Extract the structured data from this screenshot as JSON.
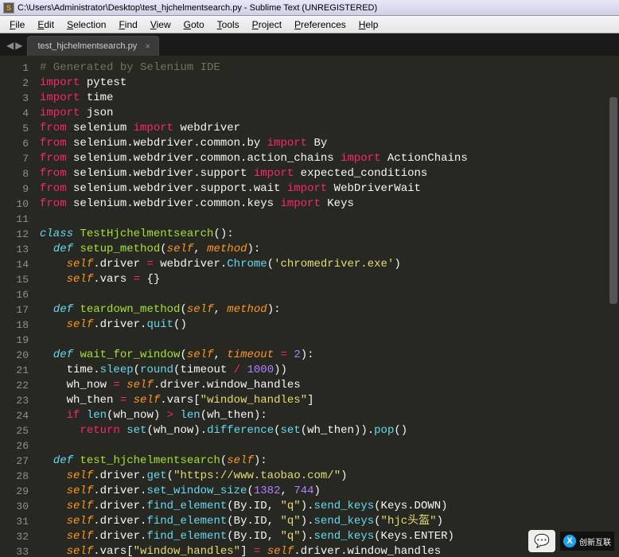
{
  "window": {
    "title": "C:\\Users\\Administrator\\Desktop\\test_hjchelmentsearch.py - Sublime Text (UNREGISTERED)"
  },
  "menu": {
    "items": [
      "File",
      "Edit",
      "Selection",
      "Find",
      "View",
      "Goto",
      "Tools",
      "Project",
      "Preferences",
      "Help"
    ]
  },
  "tab": {
    "name": "test_hjchelmentsearch.py",
    "close": "×"
  },
  "code": {
    "lines": [
      [
        {
          "t": "# Generated by Selenium IDE",
          "c": "c-comment"
        }
      ],
      [
        {
          "t": "import",
          "c": "c-keyword"
        },
        {
          "t": " pytest",
          "c": "c-plain"
        }
      ],
      [
        {
          "t": "import",
          "c": "c-keyword"
        },
        {
          "t": " time",
          "c": "c-plain"
        }
      ],
      [
        {
          "t": "import",
          "c": "c-keyword"
        },
        {
          "t": " json",
          "c": "c-plain"
        }
      ],
      [
        {
          "t": "from",
          "c": "c-keyword"
        },
        {
          "t": " selenium ",
          "c": "c-plain"
        },
        {
          "t": "import",
          "c": "c-keyword"
        },
        {
          "t": " webdriver",
          "c": "c-plain"
        }
      ],
      [
        {
          "t": "from",
          "c": "c-keyword"
        },
        {
          "t": " selenium.webdriver.common.by ",
          "c": "c-plain"
        },
        {
          "t": "import",
          "c": "c-keyword"
        },
        {
          "t": " By",
          "c": "c-plain"
        }
      ],
      [
        {
          "t": "from",
          "c": "c-keyword"
        },
        {
          "t": " selenium.webdriver.common.action_chains ",
          "c": "c-plain"
        },
        {
          "t": "import",
          "c": "c-keyword"
        },
        {
          "t": " ActionChains",
          "c": "c-plain"
        }
      ],
      [
        {
          "t": "from",
          "c": "c-keyword"
        },
        {
          "t": " selenium.webdriver.support ",
          "c": "c-plain"
        },
        {
          "t": "import",
          "c": "c-keyword"
        },
        {
          "t": " expected_conditions",
          "c": "c-plain"
        }
      ],
      [
        {
          "t": "from",
          "c": "c-keyword"
        },
        {
          "t": " selenium.webdriver.support.wait ",
          "c": "c-plain"
        },
        {
          "t": "import",
          "c": "c-keyword"
        },
        {
          "t": " WebDriverWait",
          "c": "c-plain"
        }
      ],
      [
        {
          "t": "from",
          "c": "c-keyword"
        },
        {
          "t": " selenium.webdriver.common.keys ",
          "c": "c-plain"
        },
        {
          "t": "import",
          "c": "c-keyword"
        },
        {
          "t": " Keys",
          "c": "c-plain"
        }
      ],
      [
        {
          "t": "",
          "c": "c-plain"
        }
      ],
      [
        {
          "t": "class",
          "c": "c-storage"
        },
        {
          "t": " ",
          "c": "c-plain"
        },
        {
          "t": "TestHjchelmentsearch",
          "c": "c-funcname"
        },
        {
          "t": "():",
          "c": "c-plain"
        }
      ],
      [
        {
          "t": "  ",
          "c": "c-plain"
        },
        {
          "t": "def",
          "c": "c-storage"
        },
        {
          "t": " ",
          "c": "c-plain"
        },
        {
          "t": "setup_method",
          "c": "c-funcname"
        },
        {
          "t": "(",
          "c": "c-plain"
        },
        {
          "t": "self",
          "c": "c-param"
        },
        {
          "t": ", ",
          "c": "c-plain"
        },
        {
          "t": "method",
          "c": "c-param"
        },
        {
          "t": "):",
          "c": "c-plain"
        }
      ],
      [
        {
          "t": "    ",
          "c": "c-plain"
        },
        {
          "t": "self",
          "c": "c-param"
        },
        {
          "t": ".driver ",
          "c": "c-plain"
        },
        {
          "t": "=",
          "c": "c-keyword"
        },
        {
          "t": " webdriver.",
          "c": "c-plain"
        },
        {
          "t": "Chrome",
          "c": "c-call"
        },
        {
          "t": "(",
          "c": "c-plain"
        },
        {
          "t": "'chromedriver.exe'",
          "c": "c-string"
        },
        {
          "t": ")",
          "c": "c-plain"
        }
      ],
      [
        {
          "t": "    ",
          "c": "c-plain"
        },
        {
          "t": "self",
          "c": "c-param"
        },
        {
          "t": ".vars ",
          "c": "c-plain"
        },
        {
          "t": "=",
          "c": "c-keyword"
        },
        {
          "t": " {}",
          "c": "c-plain"
        }
      ],
      [
        {
          "t": "",
          "c": "c-plain"
        }
      ],
      [
        {
          "t": "  ",
          "c": "c-plain"
        },
        {
          "t": "def",
          "c": "c-storage"
        },
        {
          "t": " ",
          "c": "c-plain"
        },
        {
          "t": "teardown_method",
          "c": "c-funcname"
        },
        {
          "t": "(",
          "c": "c-plain"
        },
        {
          "t": "self",
          "c": "c-param"
        },
        {
          "t": ", ",
          "c": "c-plain"
        },
        {
          "t": "method",
          "c": "c-param"
        },
        {
          "t": "):",
          "c": "c-plain"
        }
      ],
      [
        {
          "t": "    ",
          "c": "c-plain"
        },
        {
          "t": "self",
          "c": "c-param"
        },
        {
          "t": ".driver.",
          "c": "c-plain"
        },
        {
          "t": "quit",
          "c": "c-call"
        },
        {
          "t": "()",
          "c": "c-plain"
        }
      ],
      [
        {
          "t": "",
          "c": "c-plain"
        }
      ],
      [
        {
          "t": "  ",
          "c": "c-plain"
        },
        {
          "t": "def",
          "c": "c-storage"
        },
        {
          "t": " ",
          "c": "c-plain"
        },
        {
          "t": "wait_for_window",
          "c": "c-funcname"
        },
        {
          "t": "(",
          "c": "c-plain"
        },
        {
          "t": "self",
          "c": "c-param"
        },
        {
          "t": ", ",
          "c": "c-plain"
        },
        {
          "t": "timeout",
          "c": "c-param"
        },
        {
          "t": " ",
          "c": "c-plain"
        },
        {
          "t": "=",
          "c": "c-keyword"
        },
        {
          "t": " ",
          "c": "c-plain"
        },
        {
          "t": "2",
          "c": "c-number"
        },
        {
          "t": "):",
          "c": "c-plain"
        }
      ],
      [
        {
          "t": "    time.",
          "c": "c-plain"
        },
        {
          "t": "sleep",
          "c": "c-call"
        },
        {
          "t": "(",
          "c": "c-plain"
        },
        {
          "t": "round",
          "c": "c-call"
        },
        {
          "t": "(timeout ",
          "c": "c-plain"
        },
        {
          "t": "/",
          "c": "c-keyword"
        },
        {
          "t": " ",
          "c": "c-plain"
        },
        {
          "t": "1000",
          "c": "c-number"
        },
        {
          "t": "))",
          "c": "c-plain"
        }
      ],
      [
        {
          "t": "    wh_now ",
          "c": "c-plain"
        },
        {
          "t": "=",
          "c": "c-keyword"
        },
        {
          "t": " ",
          "c": "c-plain"
        },
        {
          "t": "self",
          "c": "c-param"
        },
        {
          "t": ".driver.window_handles",
          "c": "c-plain"
        }
      ],
      [
        {
          "t": "    wh_then ",
          "c": "c-plain"
        },
        {
          "t": "=",
          "c": "c-keyword"
        },
        {
          "t": " ",
          "c": "c-plain"
        },
        {
          "t": "self",
          "c": "c-param"
        },
        {
          "t": ".vars[",
          "c": "c-plain"
        },
        {
          "t": "\"window_handles\"",
          "c": "c-string"
        },
        {
          "t": "]",
          "c": "c-plain"
        }
      ],
      [
        {
          "t": "    ",
          "c": "c-plain"
        },
        {
          "t": "if",
          "c": "c-keyword"
        },
        {
          "t": " ",
          "c": "c-plain"
        },
        {
          "t": "len",
          "c": "c-call"
        },
        {
          "t": "(wh_now) ",
          "c": "c-plain"
        },
        {
          "t": ">",
          "c": "c-keyword"
        },
        {
          "t": " ",
          "c": "c-plain"
        },
        {
          "t": "len",
          "c": "c-call"
        },
        {
          "t": "(wh_then):",
          "c": "c-plain"
        }
      ],
      [
        {
          "t": "      ",
          "c": "c-plain"
        },
        {
          "t": "return",
          "c": "c-keyword"
        },
        {
          "t": " ",
          "c": "c-plain"
        },
        {
          "t": "set",
          "c": "c-call"
        },
        {
          "t": "(wh_now).",
          "c": "c-plain"
        },
        {
          "t": "difference",
          "c": "c-call"
        },
        {
          "t": "(",
          "c": "c-plain"
        },
        {
          "t": "set",
          "c": "c-call"
        },
        {
          "t": "(wh_then)).",
          "c": "c-plain"
        },
        {
          "t": "pop",
          "c": "c-call"
        },
        {
          "t": "()",
          "c": "c-plain"
        }
      ],
      [
        {
          "t": "",
          "c": "c-plain"
        }
      ],
      [
        {
          "t": "  ",
          "c": "c-plain"
        },
        {
          "t": "def",
          "c": "c-storage"
        },
        {
          "t": " ",
          "c": "c-plain"
        },
        {
          "t": "test_hjchelmentsearch",
          "c": "c-funcname"
        },
        {
          "t": "(",
          "c": "c-plain"
        },
        {
          "t": "self",
          "c": "c-param"
        },
        {
          "t": "):",
          "c": "c-plain"
        }
      ],
      [
        {
          "t": "    ",
          "c": "c-plain"
        },
        {
          "t": "self",
          "c": "c-param"
        },
        {
          "t": ".driver.",
          "c": "c-plain"
        },
        {
          "t": "get",
          "c": "c-call"
        },
        {
          "t": "(",
          "c": "c-plain"
        },
        {
          "t": "\"https://www.taobao.com/\"",
          "c": "c-string"
        },
        {
          "t": ")",
          "c": "c-plain"
        }
      ],
      [
        {
          "t": "    ",
          "c": "c-plain"
        },
        {
          "t": "self",
          "c": "c-param"
        },
        {
          "t": ".driver.",
          "c": "c-plain"
        },
        {
          "t": "set_window_size",
          "c": "c-call"
        },
        {
          "t": "(",
          "c": "c-plain"
        },
        {
          "t": "1382",
          "c": "c-number"
        },
        {
          "t": ", ",
          "c": "c-plain"
        },
        {
          "t": "744",
          "c": "c-number"
        },
        {
          "t": ")",
          "c": "c-plain"
        }
      ],
      [
        {
          "t": "    ",
          "c": "c-plain"
        },
        {
          "t": "self",
          "c": "c-param"
        },
        {
          "t": ".driver.",
          "c": "c-plain"
        },
        {
          "t": "find_element",
          "c": "c-call"
        },
        {
          "t": "(By.ID, ",
          "c": "c-plain"
        },
        {
          "t": "\"q\"",
          "c": "c-string"
        },
        {
          "t": ").",
          "c": "c-plain"
        },
        {
          "t": "send_keys",
          "c": "c-call"
        },
        {
          "t": "(Keys.DOWN)",
          "c": "c-plain"
        }
      ],
      [
        {
          "t": "    ",
          "c": "c-plain"
        },
        {
          "t": "self",
          "c": "c-param"
        },
        {
          "t": ".driver.",
          "c": "c-plain"
        },
        {
          "t": "find_element",
          "c": "c-call"
        },
        {
          "t": "(By.ID, ",
          "c": "c-plain"
        },
        {
          "t": "\"q\"",
          "c": "c-string"
        },
        {
          "t": ").",
          "c": "c-plain"
        },
        {
          "t": "send_keys",
          "c": "c-call"
        },
        {
          "t": "(",
          "c": "c-plain"
        },
        {
          "t": "\"hjc头盔\"",
          "c": "c-string"
        },
        {
          "t": ")",
          "c": "c-plain"
        }
      ],
      [
        {
          "t": "    ",
          "c": "c-plain"
        },
        {
          "t": "self",
          "c": "c-param"
        },
        {
          "t": ".driver.",
          "c": "c-plain"
        },
        {
          "t": "find_element",
          "c": "c-call"
        },
        {
          "t": "(By.ID, ",
          "c": "c-plain"
        },
        {
          "t": "\"q\"",
          "c": "c-string"
        },
        {
          "t": ").",
          "c": "c-plain"
        },
        {
          "t": "send_keys",
          "c": "c-call"
        },
        {
          "t": "(Keys.ENTER)",
          "c": "c-plain"
        }
      ],
      [
        {
          "t": "    ",
          "c": "c-plain"
        },
        {
          "t": "self",
          "c": "c-param"
        },
        {
          "t": ".vars[",
          "c": "c-plain"
        },
        {
          "t": "\"window_handles\"",
          "c": "c-string"
        },
        {
          "t": "] ",
          "c": "c-plain"
        },
        {
          "t": "=",
          "c": "c-keyword"
        },
        {
          "t": " ",
          "c": "c-plain"
        },
        {
          "t": "self",
          "c": "c-param"
        },
        {
          "t": ".driver.window_handles",
          "c": "c-plain"
        }
      ]
    ]
  },
  "watermark": {
    "brand": "创新互联"
  }
}
